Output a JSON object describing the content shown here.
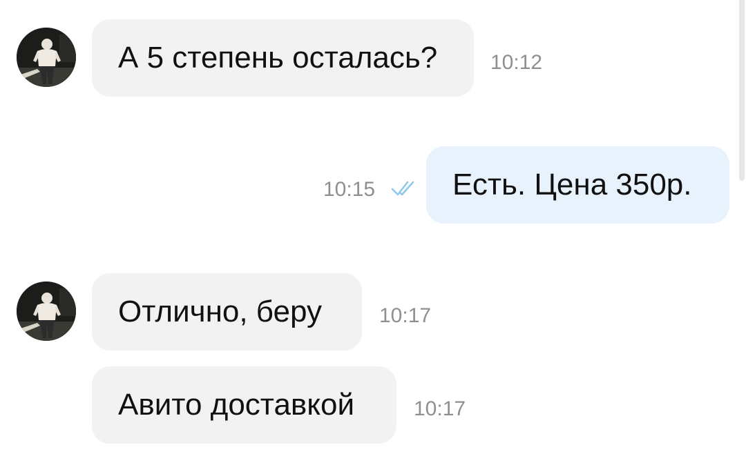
{
  "messages": [
    {
      "direction": "incoming",
      "text": "А 5 степень осталась?",
      "time": "10:12",
      "avatar": "avatar-photo"
    },
    {
      "direction": "outgoing",
      "text": "Есть. Цена 350р.",
      "time": "10:15",
      "status_icon": "double-check-icon"
    },
    {
      "direction": "incoming",
      "text": "Отлично, беру",
      "time": "10:17",
      "avatar": "avatar-photo"
    },
    {
      "direction": "incoming",
      "text": "Авито доставкой",
      "time": "10:17"
    }
  ],
  "colors": {
    "incoming_bubble": "#f2f2f2",
    "outgoing_bubble": "#e8f2fd",
    "timestamp": "#8f8f8f",
    "read_check": "#8ec8ec"
  }
}
